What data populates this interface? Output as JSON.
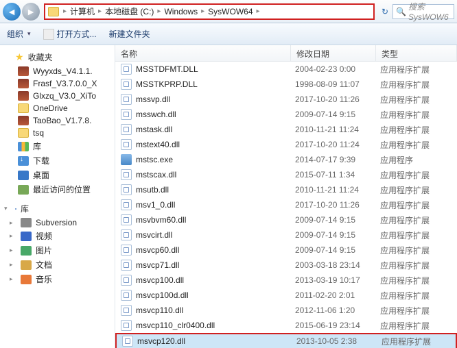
{
  "address": {
    "crumbs": [
      "计算机",
      "本地磁盘 (C:)",
      "Windows",
      "SysWOW64"
    ],
    "search_placeholder": "搜索 SysWOW6"
  },
  "toolbar": {
    "organize": "组织",
    "open_with": "打开方式...",
    "new_folder": "新建文件夹"
  },
  "sidebar": {
    "favorites": "收藏夹",
    "fav_items": [
      {
        "label": "Wyyxds_V4.1.1.",
        "ico": "ico-rar"
      },
      {
        "label": "Frasf_V3.7.0.0_X",
        "ico": "ico-rar"
      },
      {
        "label": "Glxzq_V3.0_XiTo",
        "ico": "ico-rar"
      },
      {
        "label": "OneDrive",
        "ico": "ico-folder"
      },
      {
        "label": "TaoBao_V1.7.8.",
        "ico": "ico-rar"
      },
      {
        "label": "tsq",
        "ico": "ico-folder"
      },
      {
        "label": "库",
        "ico": "ico-lib"
      },
      {
        "label": "下载",
        "ico": "ico-dl"
      },
      {
        "label": "桌面",
        "ico": "ico-desk"
      },
      {
        "label": "最近访问的位置",
        "ico": "ico-recent"
      }
    ],
    "libraries": "库",
    "lib_items": [
      {
        "label": "Subversion",
        "ico": "ico-sub"
      },
      {
        "label": "视频",
        "ico": "ico-vid"
      },
      {
        "label": "图片",
        "ico": "ico-pic"
      },
      {
        "label": "文档",
        "ico": "ico-doc"
      },
      {
        "label": "音乐",
        "ico": "ico-mus"
      }
    ]
  },
  "columns": {
    "name": "名称",
    "date": "修改日期",
    "type": "类型"
  },
  "files": [
    {
      "name": "MSSTDFMT.DLL",
      "date": "2004-02-23 0:00",
      "type": "应用程序扩展",
      "ico": "dll"
    },
    {
      "name": "MSSTKPRP.DLL",
      "date": "1998-08-09 11:07",
      "type": "应用程序扩展",
      "ico": "dll"
    },
    {
      "name": "mssvp.dll",
      "date": "2017-10-20 11:26",
      "type": "应用程序扩展",
      "ico": "dll"
    },
    {
      "name": "msswch.dll",
      "date": "2009-07-14 9:15",
      "type": "应用程序扩展",
      "ico": "dll"
    },
    {
      "name": "mstask.dll",
      "date": "2010-11-21 11:24",
      "type": "应用程序扩展",
      "ico": "dll"
    },
    {
      "name": "mstext40.dll",
      "date": "2017-10-20 11:24",
      "type": "应用程序扩展",
      "ico": "dll"
    },
    {
      "name": "mstsc.exe",
      "date": "2014-07-17 9:39",
      "type": "应用程序",
      "ico": "exe"
    },
    {
      "name": "mstscax.dll",
      "date": "2015-07-11 1:34",
      "type": "应用程序扩展",
      "ico": "dll"
    },
    {
      "name": "msutb.dll",
      "date": "2010-11-21 11:24",
      "type": "应用程序扩展",
      "ico": "dll"
    },
    {
      "name": "msv1_0.dll",
      "date": "2017-10-20 11:26",
      "type": "应用程序扩展",
      "ico": "dll"
    },
    {
      "name": "msvbvm60.dll",
      "date": "2009-07-14 9:15",
      "type": "应用程序扩展",
      "ico": "dll"
    },
    {
      "name": "msvcirt.dll",
      "date": "2009-07-14 9:15",
      "type": "应用程序扩展",
      "ico": "dll"
    },
    {
      "name": "msvcp60.dll",
      "date": "2009-07-14 9:15",
      "type": "应用程序扩展",
      "ico": "dll"
    },
    {
      "name": "msvcp71.dll",
      "date": "2003-03-18 23:14",
      "type": "应用程序扩展",
      "ico": "dll"
    },
    {
      "name": "msvcp100.dll",
      "date": "2013-03-19 10:17",
      "type": "应用程序扩展",
      "ico": "dll"
    },
    {
      "name": "msvcp100d.dll",
      "date": "2011-02-20 2:01",
      "type": "应用程序扩展",
      "ico": "dll"
    },
    {
      "name": "msvcp110.dll",
      "date": "2012-11-06 1:20",
      "type": "应用程序扩展",
      "ico": "dll"
    },
    {
      "name": "msvcp110_clr0400.dll",
      "date": "2015-06-19 23:14",
      "type": "应用程序扩展",
      "ico": "dll"
    },
    {
      "name": "msvcp120.dll",
      "date": "2013-10-05 2:38",
      "type": "应用程序扩展",
      "ico": "dll",
      "sel": true
    }
  ]
}
